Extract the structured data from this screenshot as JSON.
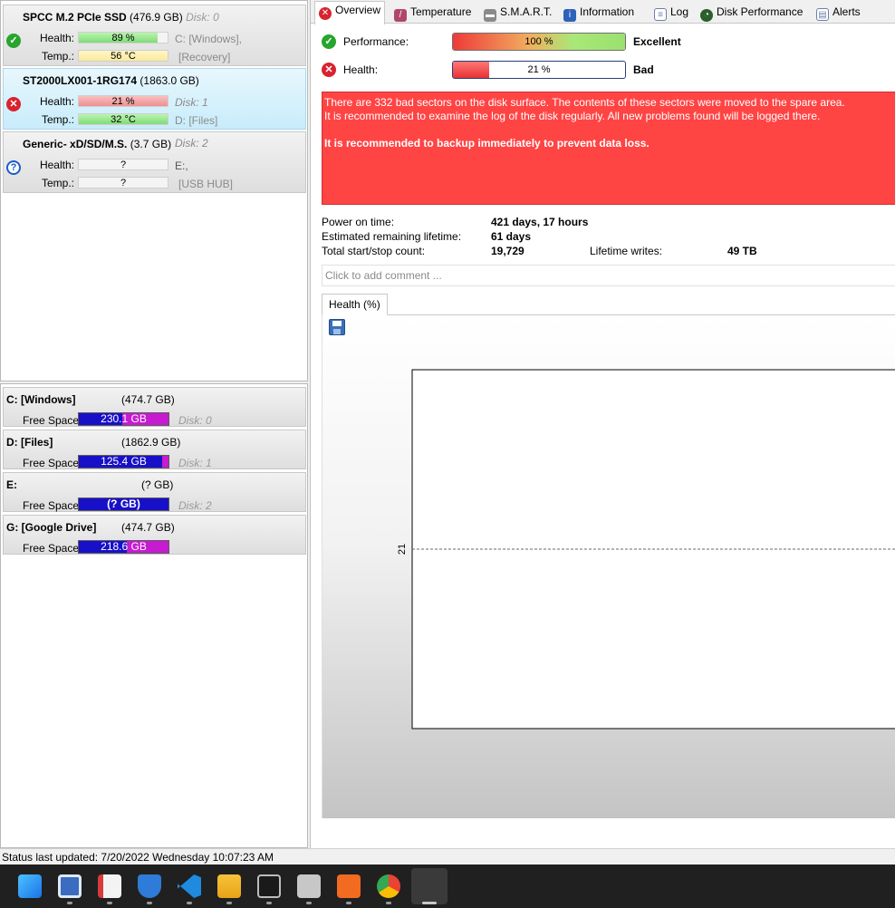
{
  "disks": [
    {
      "name": "SPCC M.2 PCIe SSD",
      "size": "(476.9 GB)",
      "disk_label": "Disk: 0",
      "status": "ok",
      "health_label": "Health:",
      "health_value": "89 %",
      "health_pct": 89,
      "temp_label": "Temp.:",
      "temp_value": "56 °C",
      "temp_pct": 100,
      "volumes_line1": "C: [Windows],",
      "volumes_line2": "[Recovery]"
    },
    {
      "name": "ST2000LX001-1RG174",
      "size": "(1863.0 GB)",
      "disk_label": "Disk: 1",
      "status": "bad",
      "health_label": "Health:",
      "health_value": "21 %",
      "health_pct": 100,
      "temp_label": "Temp.:",
      "temp_value": "32 °C",
      "temp_pct": 100,
      "volumes_line1": "D: [Files]",
      "volumes_line2": ""
    },
    {
      "name": "Generic- xD/SD/M.S.",
      "size": "(3.7 GB)",
      "disk_label": "Disk: 2",
      "status": "unknown",
      "health_label": "Health:",
      "health_value": "?",
      "temp_label": "Temp.:",
      "temp_value": "?",
      "volumes_line1": "E:,",
      "volumes_line2": "[USB HUB]"
    }
  ],
  "partitions": [
    {
      "name": "C: [Windows]",
      "size": "(474.7 GB)",
      "free_label": "Free Space",
      "free_value": "230.1 GB",
      "free_pct": 48,
      "disk": "Disk: 0"
    },
    {
      "name": "D: [Files]",
      "size": "(1862.9 GB)",
      "free_label": "Free Space",
      "free_value": "125.4 GB",
      "free_pct": 93,
      "disk": "Disk: 1"
    },
    {
      "name": "E:",
      "size": "(? GB)",
      "free_label": "Free Space",
      "free_value": "(? GB)",
      "free_pct": 100,
      "disk": "Disk: 2"
    },
    {
      "name": "G: [Google Drive]",
      "size": "(474.7 GB)",
      "free_label": "Free Space",
      "free_value": "218.6 GB",
      "free_pct": 54,
      "disk": ""
    }
  ],
  "tabs": [
    "Overview",
    "Temperature",
    "S.M.A.R.T.",
    "Information",
    "Log",
    "Disk Performance",
    "Alerts"
  ],
  "overview": {
    "performance_label": "Performance:",
    "performance_value": "100 %",
    "performance_pct": 100,
    "performance_rating": "Excellent",
    "health_label": "Health:",
    "health_value": "21 %",
    "health_pct": 21,
    "health_rating": "Bad",
    "alert_line1": "There are 332 bad sectors on the disk surface. The contents of these sectors were moved to the spare area.",
    "alert_line2": "It is recommended to examine the log of the disk regularly. All new problems found will be logged there.",
    "alert_line3": "It is recommended to backup immediately to prevent data loss.",
    "power_on_label": "Power on time:",
    "power_on_value": "421 days, 17 hours",
    "remaining_label": "Estimated remaining lifetime:",
    "remaining_value": "61 days",
    "startstop_label": "Total start/stop count:",
    "startstop_value": "19,729",
    "writes_label": "Lifetime writes:",
    "writes_value": "49 TB",
    "comment_placeholder": "Click to add comment ..."
  },
  "chart_tab": "Health (%)",
  "chart_data": {
    "type": "line",
    "title": "",
    "xlabel": "",
    "ylabel": "",
    "series": [
      {
        "values": [
          21
        ]
      }
    ],
    "y_ticks": [
      "21"
    ]
  },
  "status_bar": "Status last updated: 7/20/2022 Wednesday 10:07:23 AM",
  "taskbar_icons": [
    "start-icon",
    "widgets-icon",
    "snipping-tool-icon",
    "security-icon",
    "vscode-icon",
    "file-explorer-icon",
    "terminal-icon",
    "app-icon",
    "xampp-icon",
    "chrome-icon",
    "hard-disk-sentinel-icon"
  ],
  "colors": {
    "alert_bg": "#ff4444",
    "free_used": "#1810c8",
    "free_remaining": "#c61bd0",
    "ok": "#27a52d",
    "bad": "#d8232f"
  }
}
